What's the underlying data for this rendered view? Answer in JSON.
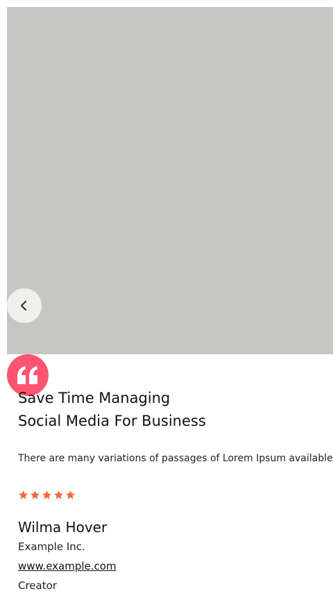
{
  "testimonial": {
    "image_alt": "",
    "title_lines": [
      "Save Time Managing",
      "Social Media For Business"
    ],
    "description": "There are many variations of passages of Lorem Ipsum available, bu",
    "rating": 5,
    "rating_max": 5,
    "author": {
      "name": "Wilma Hover",
      "company": "Example Inc.",
      "website": "www.example.com",
      "role": "Creator"
    }
  },
  "icons": {
    "prev": "chevron-left-icon",
    "quote": "quote-icon",
    "star": "star-icon"
  },
  "colors": {
    "image_placeholder": "#c6c6c3",
    "quote_badge": "#ff5471",
    "star": "#f26a3a",
    "nav_button": "#efefee"
  }
}
